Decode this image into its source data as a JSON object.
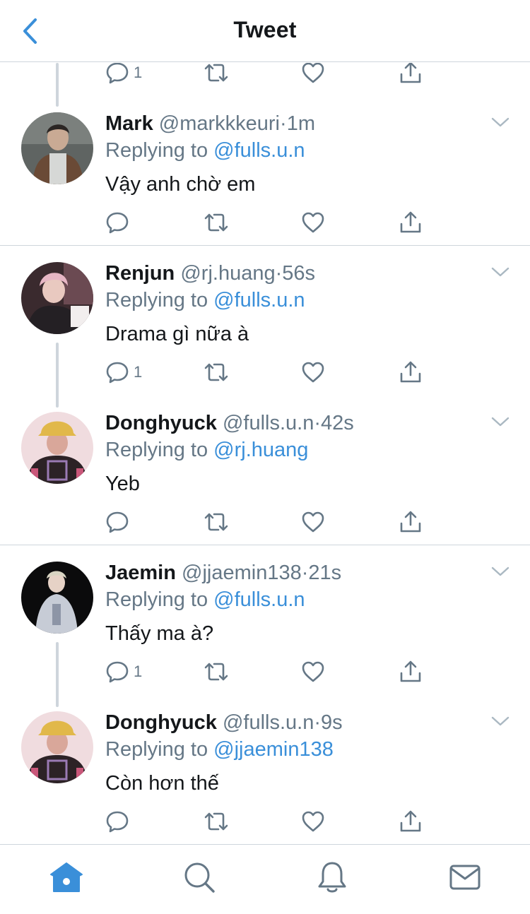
{
  "header": {
    "title": "Tweet",
    "back_icon": "chevron-left-icon"
  },
  "partial_actions": {
    "reply_count": "1"
  },
  "tweets": [
    {
      "name": "Mark",
      "handle": "@markkkeuri",
      "dot": "·",
      "time": "1m",
      "replying_prefix": "Replying to",
      "replying_to": "@fulls.u.n",
      "text": "Vậy anh chờ em",
      "reply_count": ""
    },
    {
      "name": "Renjun",
      "handle": "@rj.huang",
      "dot": "·",
      "time": "56s",
      "replying_prefix": "Replying to",
      "replying_to": "@fulls.u.n",
      "text": "Drama gì nữa à",
      "reply_count": "1"
    },
    {
      "name": "Donghyuck",
      "handle": "@fulls.u.n",
      "dot": "·",
      "time": "42s",
      "replying_prefix": "Replying to",
      "replying_to": "@rj.huang",
      "text": "Yeb",
      "reply_count": ""
    },
    {
      "name": "Jaemin",
      "handle": "@jjaemin138",
      "dot": "·",
      "time": "21s",
      "replying_prefix": "Replying to",
      "replying_to": "@fulls.u.n",
      "text": "Thấy ma à?",
      "reply_count": "1"
    },
    {
      "name": "Donghyuck",
      "handle": "@fulls.u.n",
      "dot": "·",
      "time": "9s",
      "replying_prefix": "Replying to",
      "replying_to": "@jjaemin138",
      "text": "Còn hơn thế",
      "reply_count": ""
    }
  ],
  "tabbar": {
    "items": [
      "home-icon",
      "search-icon",
      "notifications-icon",
      "messages-icon"
    ],
    "active": "home-icon"
  },
  "colors": {
    "accent": "#3a8fd9",
    "secondary_text": "#657786",
    "primary_text": "#14171a",
    "divider": "#ced5dc"
  }
}
